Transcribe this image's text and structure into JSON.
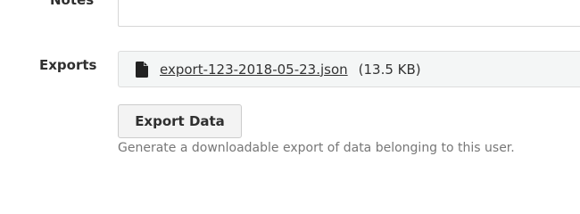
{
  "notes": {
    "label": "Notes"
  },
  "exports": {
    "label": "Exports",
    "file": {
      "icon": "file-icon",
      "name": "export-123-2018-05-23.json",
      "size": "(13.5 KB)"
    }
  },
  "export_button": {
    "label": "Export Data"
  },
  "help_text": "Generate a downloadable export of data belonging to this user.",
  "colors": {
    "label_text": "#2f2f2f",
    "help_text": "#777777",
    "exports_box_bg": "#f4f6f6",
    "button_bg": "#f3f3f3",
    "border": "#d6d6d6"
  }
}
